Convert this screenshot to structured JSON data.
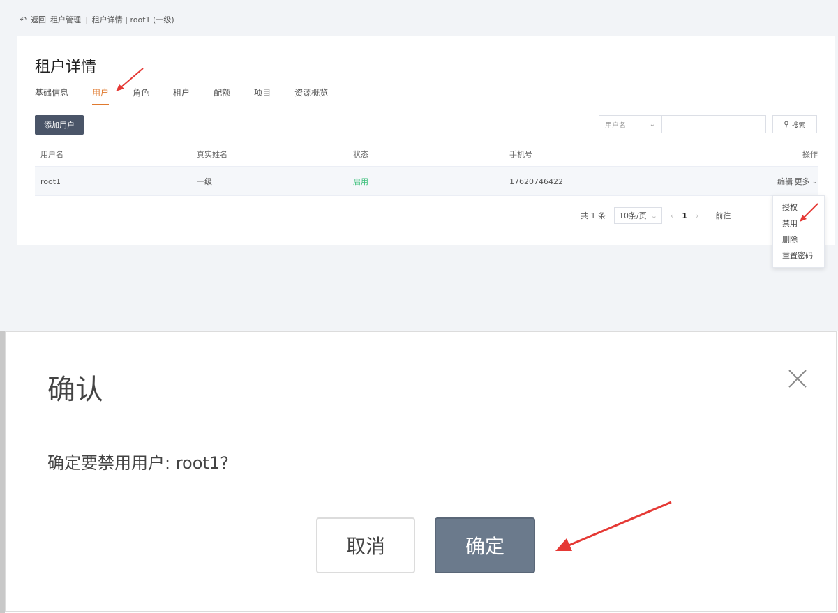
{
  "topbar": {
    "back_label": "返回",
    "crumb1": "租户管理",
    "crumb2": "租户详情 | root1 (一级)"
  },
  "card": {
    "title": "租户详情",
    "tabs": [
      "基础信息",
      "用户",
      "角色",
      "租户",
      "配额",
      "项目",
      "资源概览"
    ],
    "active_tab": 1,
    "add_user_label": "添加用户",
    "search_field_label": "用户名",
    "search_value": "",
    "search_button_label": "搜索"
  },
  "table": {
    "headers": [
      "用户名",
      "真实姓名",
      "状态",
      "手机号",
      "操作"
    ],
    "rows": [
      {
        "username": "root1",
        "realname": "一级",
        "status": "启用",
        "phone": "17620746422",
        "edit": "编辑",
        "more": "更多"
      }
    ]
  },
  "pagination": {
    "total_text": "共 1 条",
    "page_size": "10条/页",
    "current_page": "1",
    "goto": "前往"
  },
  "dropdown": {
    "items": [
      "授权",
      "禁用",
      "删除",
      "重置密码"
    ]
  },
  "dialog": {
    "title": "确认",
    "message": "确定要禁用用户: root1?",
    "cancel_label": "取消",
    "ok_label": "确定"
  },
  "colors": {
    "accent": "#e07a2f",
    "primary_dark": "#4a5568",
    "status_green": "#3bbf7a",
    "ok_button": "#6b7a8c",
    "annotation_red": "#e53935"
  }
}
